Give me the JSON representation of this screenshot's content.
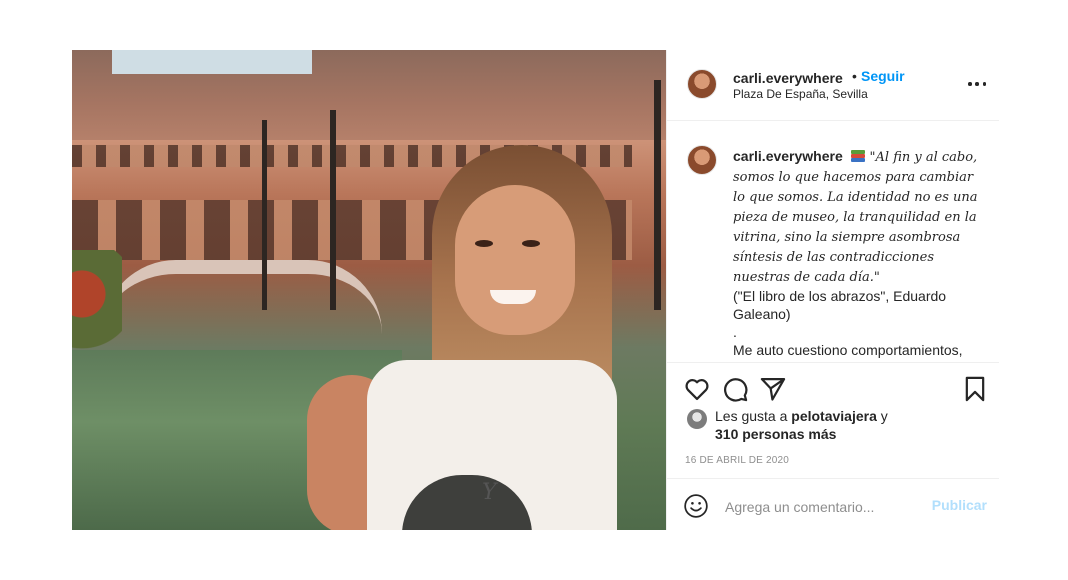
{
  "post": {
    "username": "carli.everywhere",
    "separator": "•",
    "follow_label": "Seguir",
    "location": "Plaza De España, Sevilla",
    "more_icon": "more-horizontal-icon",
    "photo_print_text": "Y",
    "caption": {
      "username": "carli.everywhere",
      "emoji": "books-icon",
      "quote": "\"Al fin y al cabo, somos lo que hacemos para cambiar lo que somos. La identidad no es una pieza de museo, la tranquilidad en la vitrina, sino la siempre asombrosa síntesis de las contradicciones nuestras de cada día.\"",
      "source": "(\"El libro de los abrazos\", Eduardo Galeano)",
      "dot_line": ".",
      "body": "Me auto cuestiono comportamientos, decisiones, miedos y formas de pensar negativas."
    },
    "actions": {
      "like_icon": "heart-icon",
      "comment_icon": "comment-icon",
      "share_icon": "share-icon",
      "save_icon": "bookmark-icon"
    },
    "likes": {
      "prefix": "Les gusta a",
      "first_user": "pelotaviajera",
      "joiner": "y",
      "others": "310 personas más"
    },
    "date": "16 DE ABRIL DE 2020",
    "comment": {
      "placeholder": "Agrega un comentario...",
      "value": "",
      "publish_label": "Publicar",
      "emoji_icon": "smiley-icon"
    },
    "colors": {
      "link_blue": "#0095f6",
      "publish_disabled": "#b2dffc",
      "border": "#efefef",
      "muted": "#8e8e8e"
    }
  }
}
